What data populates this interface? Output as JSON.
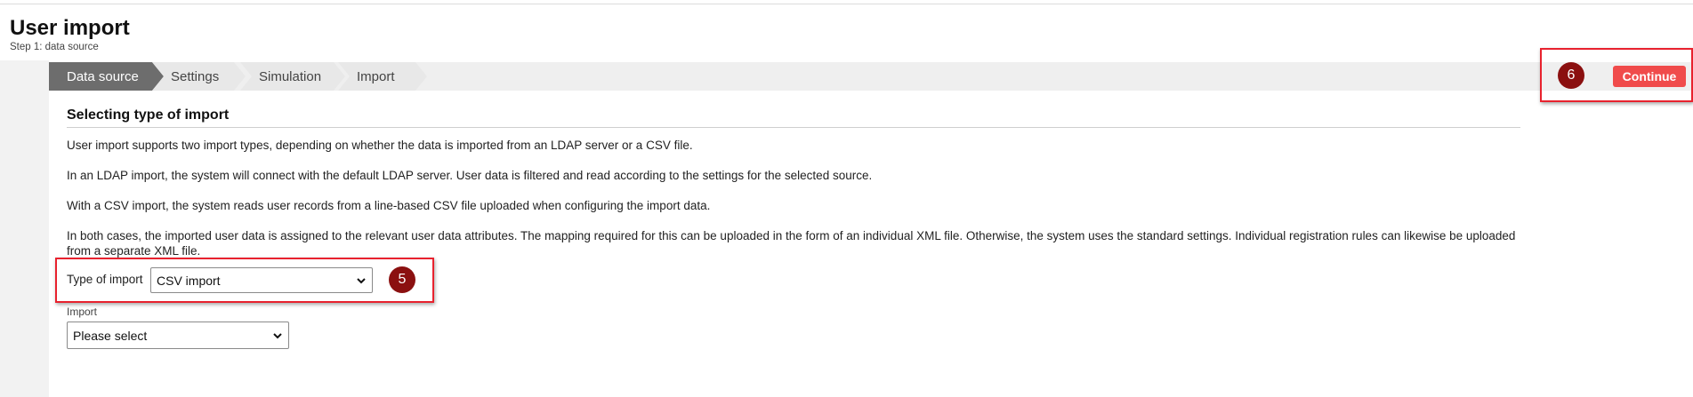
{
  "page": {
    "title": "User import",
    "subtitle": "Step 1: data source"
  },
  "steps": [
    {
      "label": "Data source",
      "active": true
    },
    {
      "label": "Settings",
      "active": false
    },
    {
      "label": "Simulation",
      "active": false
    },
    {
      "label": "Import",
      "active": false
    }
  ],
  "toolbar": {
    "continue_label": "Continue",
    "badge_label": "6"
  },
  "content": {
    "section_title": "Selecting type of import",
    "paragraphs": [
      "User import supports two import types, depending on whether the data is imported from an LDAP server or a CSV file.",
      "In an LDAP import, the system will connect with the default LDAP server. User data is filtered and read according to the settings for the selected source.",
      "With a CSV import, the system reads user records from a line-based CSV file uploaded when configuring the import data.",
      "In both cases, the imported user data is assigned to the relevant user data attributes. The mapping required for this can be uploaded in the form of an individual XML file. Otherwise, the system uses the standard settings. Individual registration rules can likewise be uploaded from a separate XML file."
    ],
    "type_of_import": {
      "label": "Type of import",
      "value": "CSV import",
      "badge_label": "5"
    },
    "import": {
      "label": "Import",
      "value": "Please select"
    }
  },
  "colors": {
    "annotation_border": "#e8222e",
    "badge": "#8b1010",
    "continue_button": "#f04b4b",
    "active_step": "#6d6d6d"
  }
}
